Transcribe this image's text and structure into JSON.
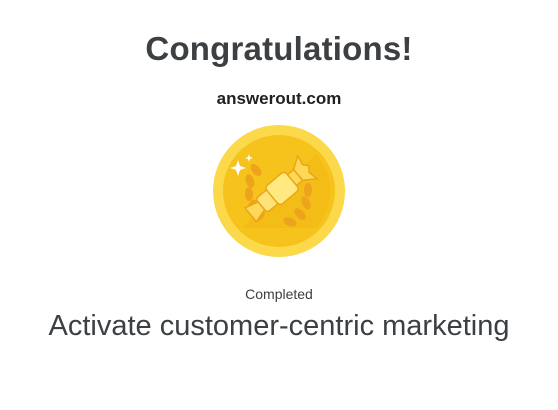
{
  "header": {
    "title": "Congratulations!",
    "site": "answerout.com"
  },
  "badge": {
    "icon": "cracker-icon",
    "colors": {
      "outer": "#f9ce3d",
      "inner": "#f4bd1a",
      "wreath": "#f0a91c",
      "cracker": "#ffe169",
      "sparkle": "#ffffff"
    }
  },
  "result": {
    "status": "Completed",
    "course_name": "Activate customer-centric marketing"
  }
}
